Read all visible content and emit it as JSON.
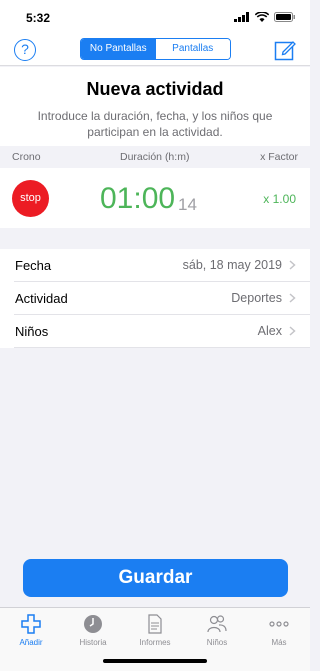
{
  "status": {
    "time": "5:32"
  },
  "nav": {
    "help_label": "?",
    "segments": [
      {
        "label": "No Pantallas",
        "active": true
      },
      {
        "label": "Pantallas",
        "active": false
      }
    ]
  },
  "header": {
    "title": "Nueva actividad",
    "subtitle": "Introduce la duración, fecha, y los niños que participan en la actividad."
  },
  "columns": {
    "crono": "Crono",
    "duration": "Duración (h:m)",
    "factor": "x Factor"
  },
  "timer": {
    "stop_label": "stop",
    "duration": "01:00",
    "seconds": "14",
    "factor": "x 1.00"
  },
  "details": [
    {
      "label": "Fecha",
      "value": "sáb, 18 may 2019"
    },
    {
      "label": "Actividad",
      "value": "Deportes"
    },
    {
      "label": "Niños",
      "value": "Alex"
    }
  ],
  "save_label": "Guardar",
  "tabs": [
    {
      "label": "Añadir",
      "icon": "plus-icon",
      "active": true
    },
    {
      "label": "Historia",
      "icon": "clock-icon",
      "active": false
    },
    {
      "label": "Informes",
      "icon": "document-icon",
      "active": false
    },
    {
      "label": "Niños",
      "icon": "people-icon",
      "active": false
    },
    {
      "label": "Más",
      "icon": "more-icon",
      "active": false
    }
  ],
  "colors": {
    "accent": "#1b7ef2",
    "green": "#4db559",
    "stop": "#ec1c24"
  }
}
